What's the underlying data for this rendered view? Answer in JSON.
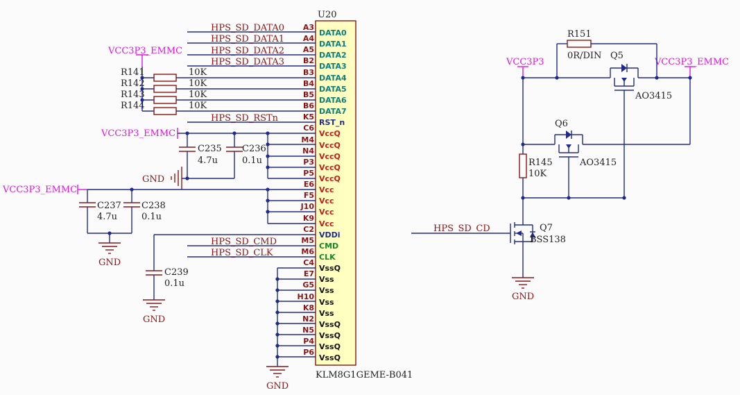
{
  "ic": {
    "ref": "U20",
    "part": "KLM8G1GEME-B041",
    "pins": [
      {
        "num": "A3",
        "name": "DATA0",
        "color": "#0b7f7a"
      },
      {
        "num": "A4",
        "name": "DATA1",
        "color": "#0b7f7a"
      },
      {
        "num": "A5",
        "name": "DATA2",
        "color": "#0b7f7a"
      },
      {
        "num": "B2",
        "name": "DATA3",
        "color": "#0b7f7a"
      },
      {
        "num": "B3",
        "name": "DATA4",
        "color": "#0b7f7a"
      },
      {
        "num": "B4",
        "name": "DATA5",
        "color": "#0b7f7a"
      },
      {
        "num": "B5",
        "name": "DATA6",
        "color": "#0b7f7a"
      },
      {
        "num": "B6",
        "name": "DATA7",
        "color": "#0b7f7a"
      },
      {
        "num": "K5",
        "name": "RST_n",
        "color": "#1f2a8c"
      },
      {
        "num": "C6",
        "name": "VccQ",
        "color": "#c61b1b"
      },
      {
        "num": "M4",
        "name": "VccQ",
        "color": "#c61b1b"
      },
      {
        "num": "N4",
        "name": "VccQ",
        "color": "#c61b1b"
      },
      {
        "num": "P3",
        "name": "VccQ",
        "color": "#c61b1b"
      },
      {
        "num": "P5",
        "name": "VccQ",
        "color": "#c61b1b"
      },
      {
        "num": "E6",
        "name": "Vcc",
        "color": "#c61b1b"
      },
      {
        "num": "F5",
        "name": "Vcc",
        "color": "#c61b1b"
      },
      {
        "num": "J10",
        "name": "Vcc",
        "color": "#c61b1b"
      },
      {
        "num": "K9",
        "name": "Vcc",
        "color": "#c61b1b"
      },
      {
        "num": "C2",
        "name": "VDDi",
        "color": "#1f2a8c"
      },
      {
        "num": "M5",
        "name": "CMD",
        "color": "#17852a"
      },
      {
        "num": "M6",
        "name": "CLK",
        "color": "#17852a"
      },
      {
        "num": "C4",
        "name": "VssQ",
        "color": "#111111"
      },
      {
        "num": "E7",
        "name": "Vss",
        "color": "#111111"
      },
      {
        "num": "G5",
        "name": "Vss",
        "color": "#111111"
      },
      {
        "num": "H10",
        "name": "Vss",
        "color": "#111111"
      },
      {
        "num": "K8",
        "name": "Vss",
        "color": "#111111"
      },
      {
        "num": "N2",
        "name": "VssQ",
        "color": "#111111"
      },
      {
        "num": "N5",
        "name": "VssQ",
        "color": "#111111"
      },
      {
        "num": "P4",
        "name": "VssQ",
        "color": "#111111"
      },
      {
        "num": "P6",
        "name": "VssQ",
        "color": "#111111"
      }
    ]
  },
  "nets": {
    "data0": "HPS_SD_DATA0",
    "data1": "HPS_SD_DATA1",
    "data2": "HPS_SD_DATA2",
    "data3": "HPS_SD_DATA3",
    "rst": "HPS_SD_RSTn",
    "cmd": "HPS_SD_CMD",
    "clk": "HPS_SD_CLK",
    "cd": "HPS_SD_CD"
  },
  "power": {
    "vcc_emmc": "VCC3P3_EMMC",
    "vcc": "VCC3P3",
    "gnd": "GND"
  },
  "resistors": [
    {
      "ref": "R141",
      "value": "10K"
    },
    {
      "ref": "R142",
      "value": "10K"
    },
    {
      "ref": "R143",
      "value": "10K"
    },
    {
      "ref": "R144",
      "value": "10K"
    },
    {
      "ref": "R145",
      "value": "10K"
    },
    {
      "ref": "R151",
      "value": "0R/DIN"
    }
  ],
  "capacitors": [
    {
      "ref": "C235",
      "value": "4.7u"
    },
    {
      "ref": "C236",
      "value": "0.1u"
    },
    {
      "ref": "C237",
      "value": "4.7u"
    },
    {
      "ref": "C238",
      "value": "0.1u"
    },
    {
      "ref": "C239",
      "value": "0.1u"
    }
  ],
  "transistors": [
    {
      "ref": "Q5",
      "part": "AO3415"
    },
    {
      "ref": "Q6",
      "part": "AO3415"
    },
    {
      "ref": "Q7",
      "part": "BSS138"
    }
  ]
}
